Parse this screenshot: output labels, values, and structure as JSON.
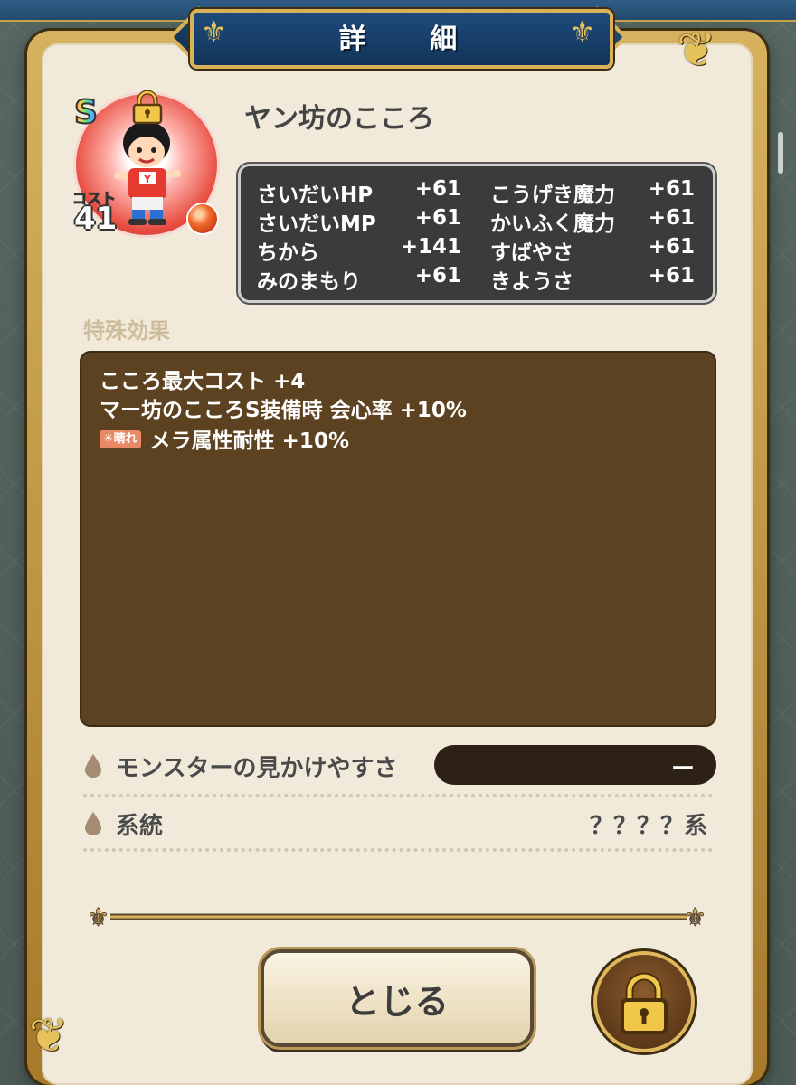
{
  "header": {
    "title": "詳 細"
  },
  "item": {
    "rank": "S",
    "cost_label": "コスト",
    "cost": "41",
    "name": "ヤン坊のこころ"
  },
  "stats": [
    {
      "label": "さいだいHP",
      "value": "+61"
    },
    {
      "label": "こうげき魔力",
      "value": "+61"
    },
    {
      "label": "さいだいMP",
      "value": "+61"
    },
    {
      "label": "かいふく魔力",
      "value": "+61"
    },
    {
      "label": "ちから",
      "value": "+141"
    },
    {
      "label": "すばやさ",
      "value": "+61"
    },
    {
      "label": "みのまもり",
      "value": "+61"
    },
    {
      "label": "きようさ",
      "value": "+61"
    }
  ],
  "effects": {
    "section_label": "特殊効果",
    "lines": [
      "こころ最大コスト +4",
      "マー坊のこころS装備時 会心率 +10%",
      "メラ属性耐性 +10%"
    ],
    "weather_tag": "☀晴れ"
  },
  "info": {
    "visibility_label": "モンスターの見かけやすさ",
    "visibility_value": "ー",
    "lineage_label": "系統",
    "lineage_value": "？？？？系"
  },
  "buttons": {
    "close_label": "とじる"
  },
  "icons": {
    "lock": "padlock-icon",
    "drop": "drop-bullet-icon",
    "fleur": "fleur-de-lis-icon"
  },
  "colors": {
    "panel": "#f1eadb",
    "effects_bg": "#5c4220",
    "stats_bg": "#3b3b3b",
    "banner": "#1d4a7b",
    "gold": "#d9b257"
  }
}
